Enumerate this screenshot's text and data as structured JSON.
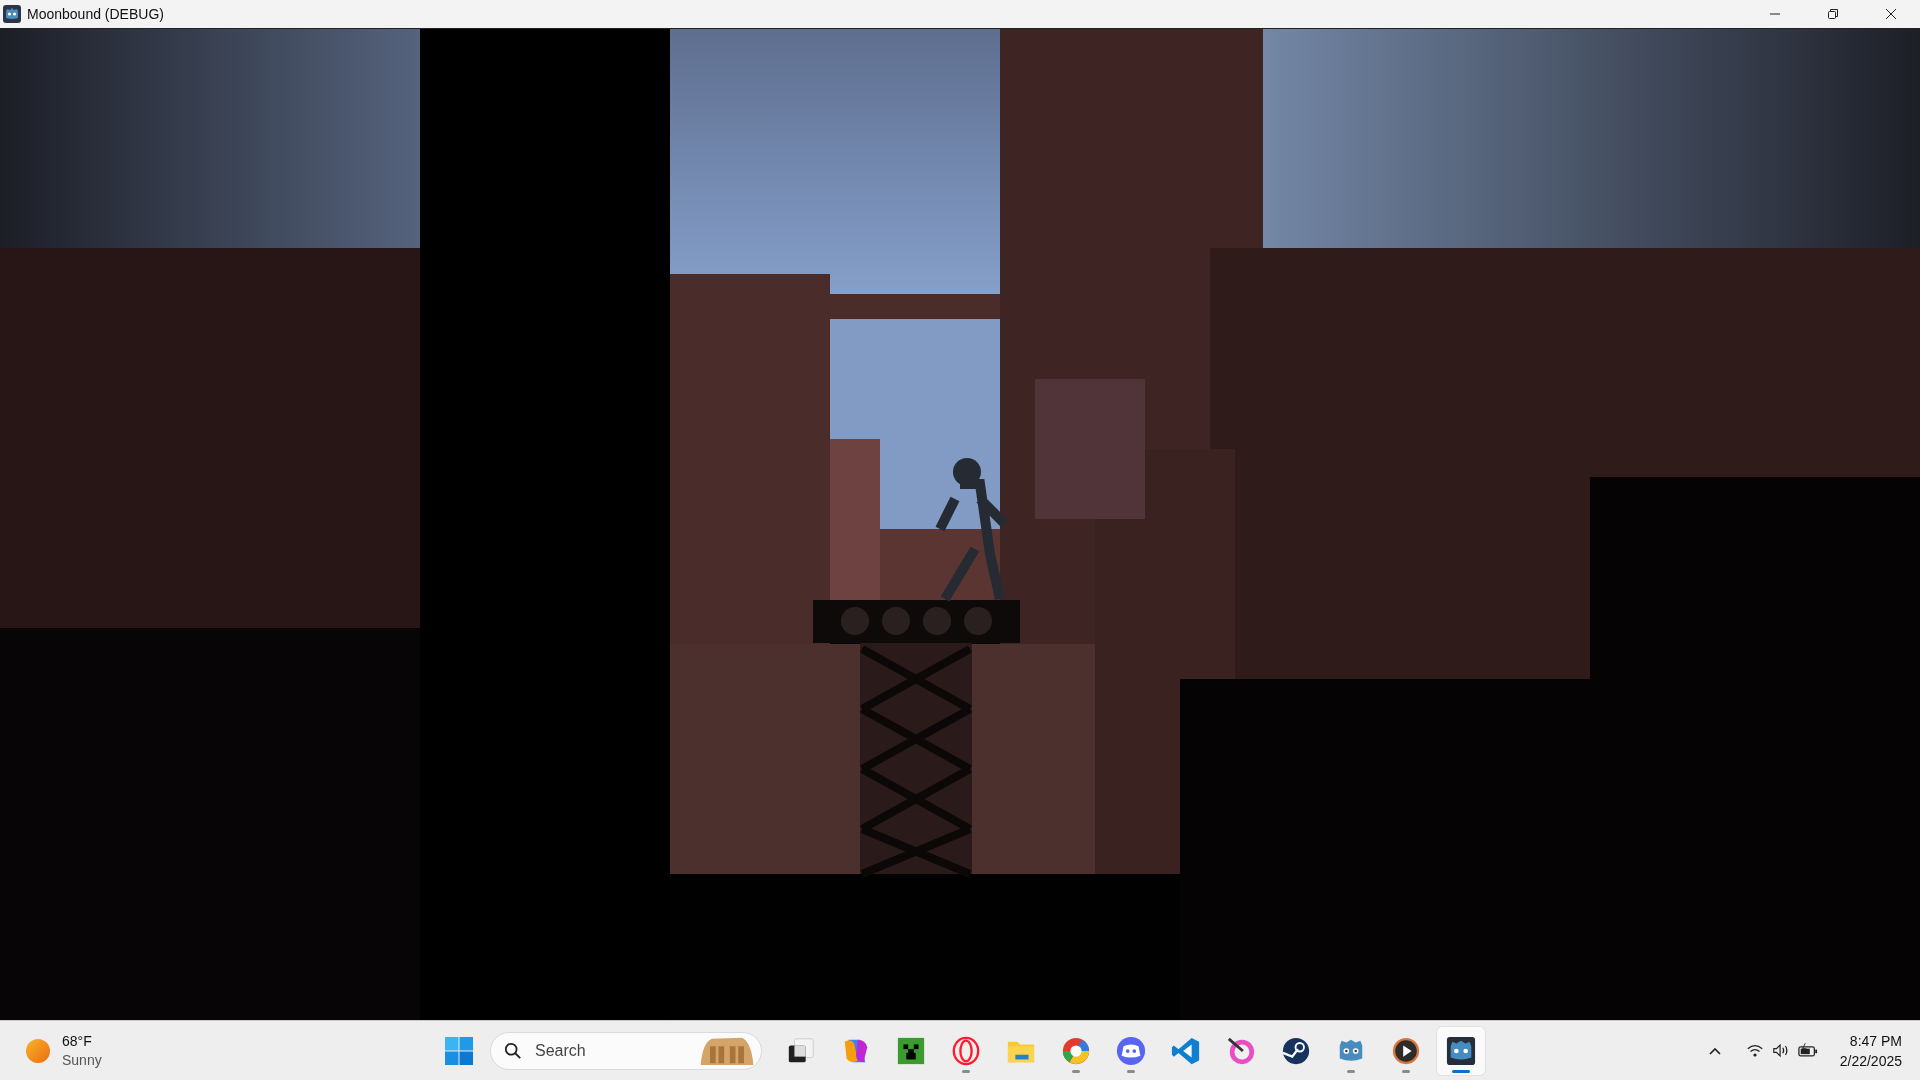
{
  "window": {
    "title": "Moonbound (DEBUG)"
  },
  "taskbar": {
    "weather": {
      "temperature": "68°F",
      "condition": "Sunny"
    },
    "search": {
      "placeholder": "Search"
    },
    "apps": [
      {
        "kind": "task-view",
        "running": false,
        "selected": false
      },
      {
        "kind": "copilot",
        "running": false,
        "selected": false
      },
      {
        "kind": "minecraft",
        "running": false,
        "selected": false
      },
      {
        "kind": "opera",
        "running": true,
        "selected": false
      },
      {
        "kind": "files",
        "running": false,
        "selected": false
      },
      {
        "kind": "chrome",
        "running": true,
        "selected": false
      },
      {
        "kind": "discord",
        "running": true,
        "selected": false
      },
      {
        "kind": "vscode",
        "running": false,
        "selected": false
      },
      {
        "kind": "krita",
        "running": false,
        "selected": false
      },
      {
        "kind": "steam",
        "running": false,
        "selected": false
      },
      {
        "kind": "godot",
        "running": true,
        "selected": false
      },
      {
        "kind": "player",
        "running": true,
        "selected": false
      },
      {
        "kind": "godot-dark",
        "running": true,
        "selected": true
      }
    ],
    "clock": {
      "time": "8:47 PM",
      "date": "2/22/2025"
    }
  }
}
